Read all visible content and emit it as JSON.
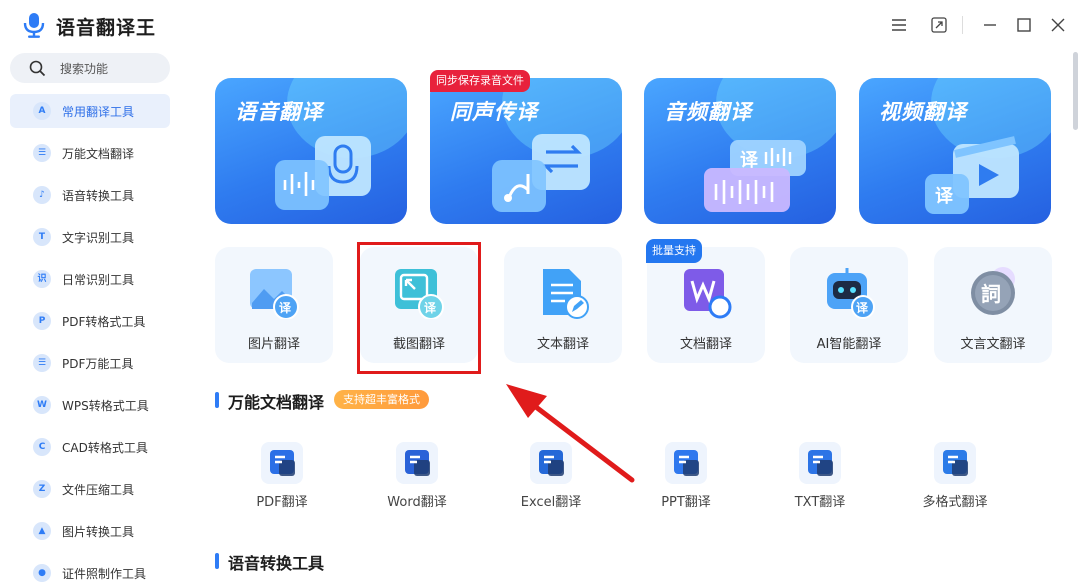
{
  "app": {
    "title": "语音翻译王"
  },
  "sidebar": {
    "search_placeholder": "搜索功能",
    "items": [
      {
        "label": "常用翻译工具",
        "icon": "A",
        "active": true
      },
      {
        "label": "万能文档翻译",
        "icon": "☰"
      },
      {
        "label": "语音转换工具",
        "icon": "♪"
      },
      {
        "label": "文字识别工具",
        "icon": "T"
      },
      {
        "label": "日常识别工具",
        "icon": "识"
      },
      {
        "label": "PDF转格式工具",
        "icon": "P"
      },
      {
        "label": "PDF万能工具",
        "icon": "☰"
      },
      {
        "label": "WPS转格式工具",
        "icon": "W"
      },
      {
        "label": "CAD转格式工具",
        "icon": "C"
      },
      {
        "label": "文件压缩工具",
        "icon": "Z"
      },
      {
        "label": "图片转换工具",
        "icon": "▲"
      },
      {
        "label": "证件照制作工具",
        "icon": "●"
      }
    ]
  },
  "main": {
    "big_cards": [
      {
        "title": "语音翻译"
      },
      {
        "title": "同声传译",
        "badge": "同步保存录音文件"
      },
      {
        "title": "音频翻译"
      },
      {
        "title": "视频翻译"
      }
    ],
    "small_cards": [
      {
        "label": "图片翻译"
      },
      {
        "label": "截图翻译"
      },
      {
        "label": "文本翻译"
      },
      {
        "label": "文档翻译",
        "badge": "批量支持"
      },
      {
        "label": "AI智能翻译"
      },
      {
        "label": "文言文翻译"
      }
    ],
    "section_doc": {
      "title": "万能文档翻译",
      "tag": "支持超丰富格式"
    },
    "doc_items": [
      {
        "label": "PDF翻译",
        "color": "#2b6fe6"
      },
      {
        "label": "Word翻译",
        "color": "#2a62d8"
      },
      {
        "label": "Excel翻译",
        "color": "#2468d8"
      },
      {
        "label": "PPT翻译",
        "color": "#2f78ee"
      },
      {
        "label": "TXT翻译",
        "color": "#2c74e6"
      },
      {
        "label": "多格式翻译",
        "color": "#2b7be8"
      }
    ],
    "section_voice": {
      "title": "语音转换工具"
    },
    "icon_glyph": "译",
    "classic_glyph": "詞"
  },
  "colors": {
    "accent": "#2e7cf6",
    "highlight": "#e01b1b",
    "badge_red": "#e8213c"
  }
}
